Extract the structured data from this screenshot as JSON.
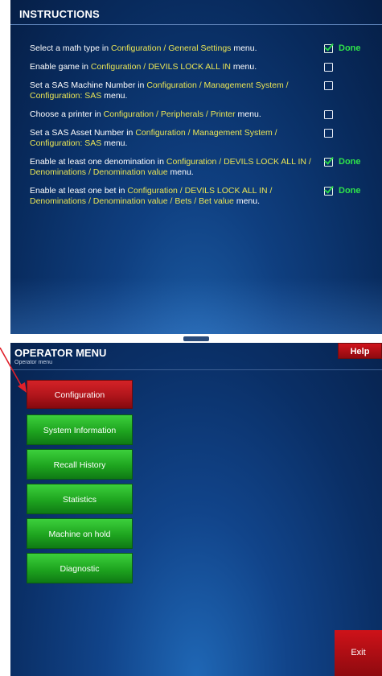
{
  "instructions": {
    "title": "INSTRUCTIONS",
    "tasks": [
      {
        "text": [
          "Select a math type in ",
          "Configuration / General Settings",
          " menu."
        ],
        "status": "Done"
      },
      {
        "text": [
          "Enable game in ",
          "Configuration / DEVILS LOCK ALL IN",
          " menu."
        ],
        "status": ""
      },
      {
        "text": [
          "Set a SAS Machine Number in ",
          "Configuration / Management System / Configuration: SAS",
          " menu."
        ],
        "status": ""
      },
      {
        "text": [
          "Choose a printer in ",
          "Configuration / Peripherals / Printer",
          " menu."
        ],
        "status": ""
      },
      {
        "text": [
          "Set a SAS Asset Number in ",
          "Configuration / Management System / Configuration: SAS",
          " menu."
        ],
        "status": ""
      },
      {
        "text": [
          "Enable at least one denomination in ",
          "Configuration / DEVILS LOCK ALL IN / Denominations / Denomination value",
          " menu."
        ],
        "status": "Done"
      },
      {
        "text": [
          "Enable at least one bet in ",
          "Configuration / DEVILS LOCK ALL IN / Denominations / Denomination value / Bets / Bet value",
          " menu."
        ],
        "status": "Done"
      }
    ]
  },
  "operator_menu": {
    "title": "OPERATOR MENU",
    "subtitle": "Operator menu",
    "help_label": "Help",
    "buttons": [
      {
        "label": "Configuration",
        "selected": true
      },
      {
        "label": "System Information",
        "selected": false
      },
      {
        "label": "Recall History",
        "selected": false
      },
      {
        "label": "Statistics",
        "selected": false
      },
      {
        "label": "Machine on hold",
        "selected": false
      },
      {
        "label": "Diagnostic",
        "selected": false
      }
    ],
    "exit_label": "Exit"
  },
  "colors": {
    "highlight_text": "#e9e455",
    "done_green": "#2fe34a",
    "menu_green": "#1ea41f",
    "selected_red": "#b0151b",
    "annotation_arrow": "#e0202a"
  },
  "icons": {
    "checkbox": "checkbox-icon",
    "annotation": "annotation-arrow"
  }
}
